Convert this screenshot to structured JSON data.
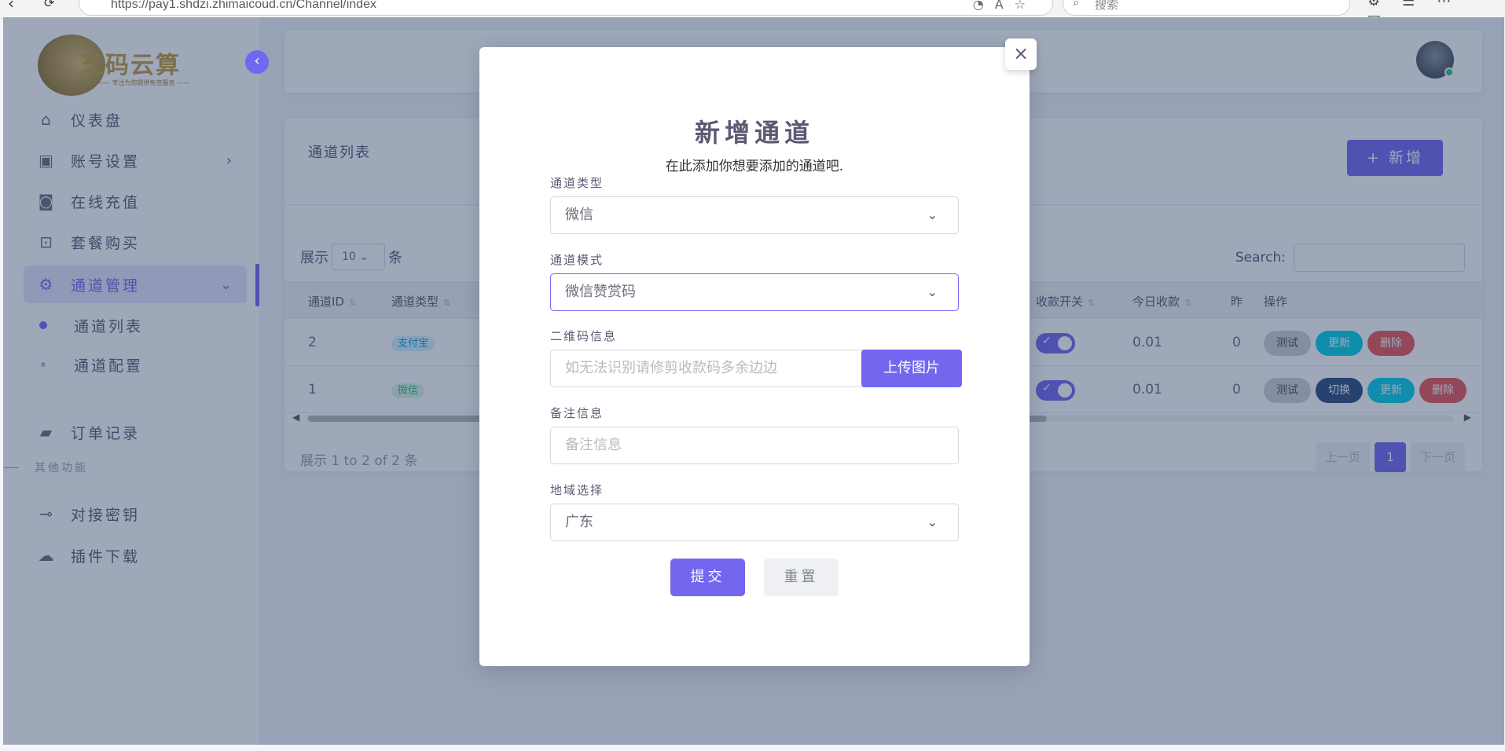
{
  "browser": {
    "url": "https://pay1.shdzi.zhimaicoud.cn/Channel/index",
    "search_placeholder": "搜索"
  },
  "sidebar": {
    "logo_text": "芝码云算",
    "logo_sub": "—— 专注为您提供免签服务 ——",
    "items": [
      {
        "label": "仪表盘",
        "icon": "home-icon"
      },
      {
        "label": "账号设置",
        "icon": "account-icon"
      },
      {
        "label": "在线充值",
        "icon": "camera-icon"
      },
      {
        "label": "套餐购买",
        "icon": "bag-icon"
      },
      {
        "label": "通道管理",
        "icon": "gear-icon"
      },
      {
        "label": "订单记录",
        "icon": "wallet-icon"
      }
    ],
    "sub_items": [
      {
        "label": "通道列表"
      },
      {
        "label": "通道配置"
      }
    ],
    "section_label": "其他功能",
    "other_items": [
      {
        "label": "对接密钥",
        "icon": "key-icon"
      },
      {
        "label": "插件下载",
        "icon": "cloud-download-icon"
      }
    ]
  },
  "card": {
    "title": "通道列表",
    "add_label": "+ 新增",
    "length_prefix": "展示",
    "length_value": "10",
    "length_suffix": "条",
    "search_label": "Search:",
    "headers": [
      "通道ID",
      "通道类型",
      "收款开关",
      "今日收款",
      "昨",
      "操作"
    ],
    "rows": [
      {
        "id": "2",
        "type": "支付宝",
        "today": "0.01",
        "yesterday": "0",
        "ops": [
          "测试",
          "更新",
          "删除"
        ]
      },
      {
        "id": "1",
        "type": "微信",
        "today": "0.01",
        "yesterday": "0",
        "ops": [
          "测试",
          "切换",
          "更新",
          "删除"
        ]
      }
    ],
    "info": "展示 1 to 2 of 2 条",
    "pager": {
      "prev": "上一页",
      "current": "1",
      "next": "下一页"
    }
  },
  "modal": {
    "title": "新增通道",
    "subtitle": "在此添加你想要添加的通道吧.",
    "type_label": "通道类型",
    "type_value": "微信",
    "mode_label": "通道模式",
    "mode_value": "微信赞赏码",
    "qr_label": "二维码信息",
    "qr_placeholder": "如无法识别请修剪收款码多余边边",
    "upload_label": "上传图片",
    "remark_label": "备注信息",
    "remark_placeholder": "备注信息",
    "region_label": "地域选择",
    "region_value": "广东",
    "submit_label": "提交",
    "reset_label": "重置"
  },
  "colors": {
    "primary": "#7367f0",
    "overlay": "#223a60"
  }
}
